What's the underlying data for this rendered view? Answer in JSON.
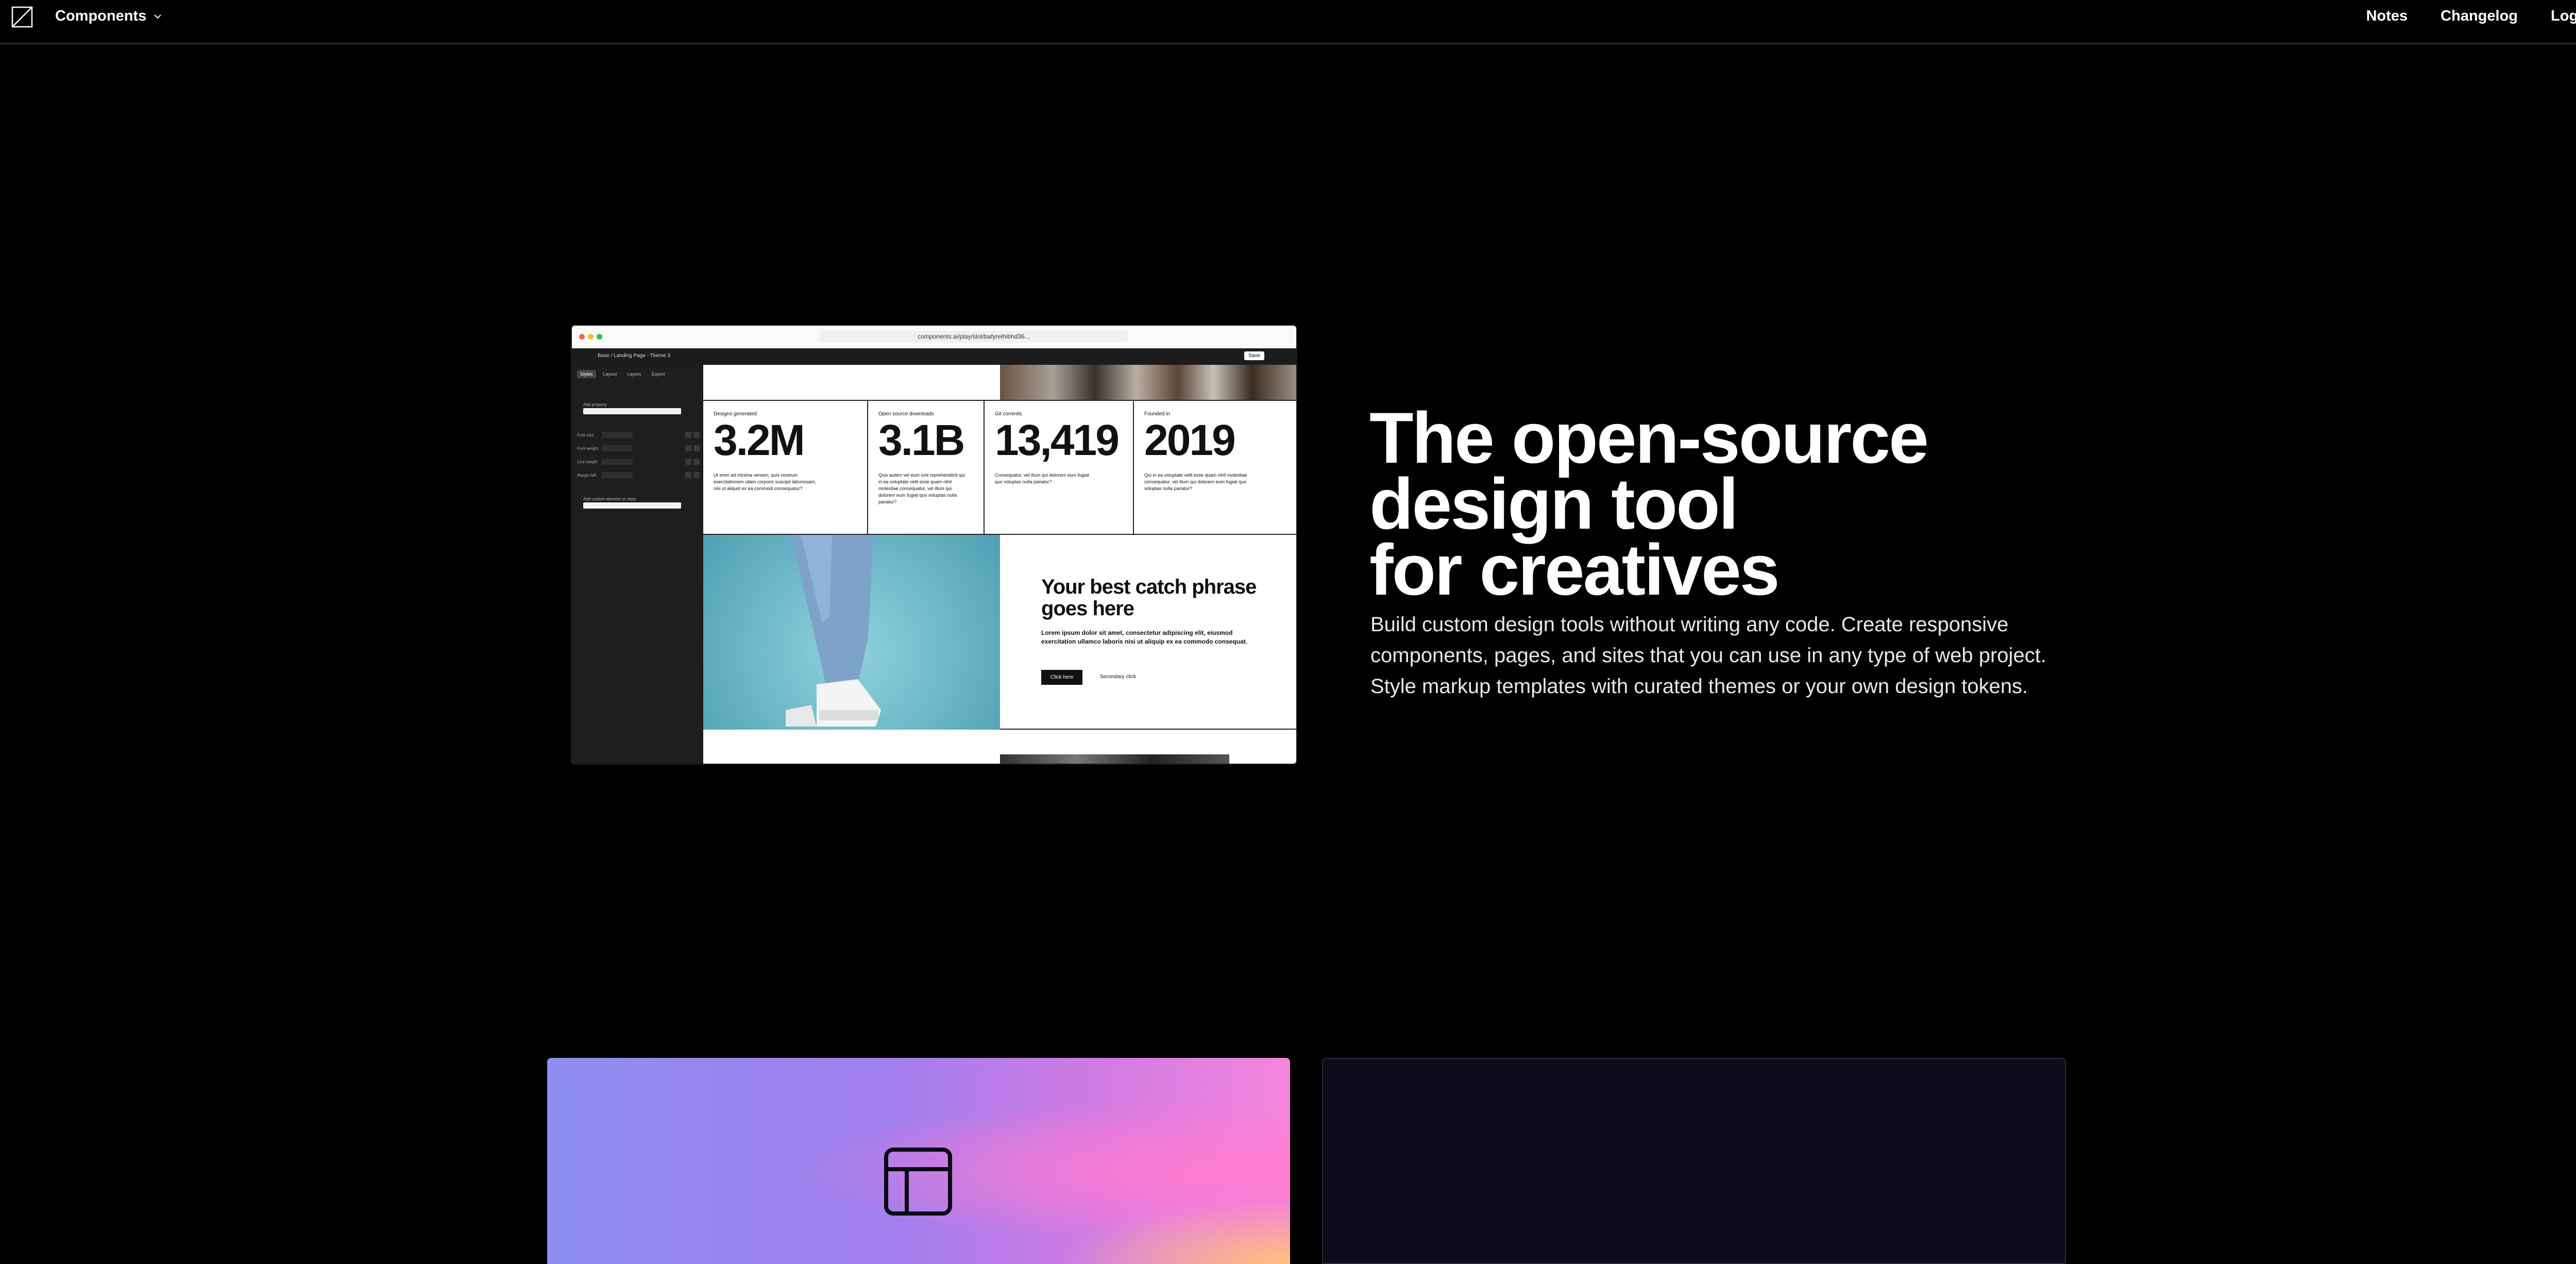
{
  "nav": {
    "brand_label": "Components",
    "links": [
      "Notes",
      "Changelog",
      "Log in"
    ]
  },
  "mockup": {
    "url": "components.ai/play/slot/bafyreihibhd36...",
    "breadcrumb": "Base  /  Landing Page - Theme 3",
    "save_label": "Save",
    "sidebar_tabs": [
      "Styles",
      "Layout",
      "Layers",
      "Export"
    ],
    "sidebar_labels": [
      "Add property",
      "Font size",
      "Font weight",
      "Line height",
      "Margin left",
      "Add custom element or class"
    ],
    "stats": [
      {
        "caption": "Designs generated",
        "value": "3.2M",
        "desc": "Ut enim ad minima veniam, quis nostrum exercitationem ullam corporis suscipit laboriosam, nisi ut aliquid ex ea commodi consequatur?"
      },
      {
        "caption": "Open source downloads",
        "value": "3.1B",
        "desc": "Quis autem vel eum iure reprehenderit qui in ea voluptate velit esse quam nihil molestiae consequatur, vel illum qui dolorem eum fugiat quo voluptas nulla pariatur?"
      },
      {
        "caption": "Git commits",
        "value": "13,419",
        "desc": "Consequatur, vel illum qui dolorem eum fugiat quo voluptas nulla pariatur?"
      },
      {
        "caption": "Founded in",
        "value": "2019",
        "desc": "Qui in ea voluptate velit esse quam nihil molestiae consequatur, vel illum qui dolorem eum fugiat quo voluptas nulla pariatur?"
      }
    ],
    "promo_heading": "Your best catch phrase goes here",
    "promo_body": "Lorem ipsum dolor sit amet, consectetur adipiscing elit, eiusmod exercitation ullamco laboris nisi ut aliquip ex ea commodo consequat.",
    "primary_btn": "Click here",
    "secondary_btn": "Secondary click"
  },
  "hero": {
    "title_lines": [
      "The open-source",
      "design tool",
      "for creatives"
    ],
    "subtitle": "Build custom design tools without writing any code. Create responsive components, pages, and sites that you can use in any type of web project. Style markup templates with curated themes or your own design tokens."
  },
  "icons": {
    "logo": "logo-icon",
    "brand_chevron": "chevron-down-icon",
    "card_icon": "layout-icon"
  },
  "colors": {
    "background": "#000000",
    "card_dark": "#0d0b1c"
  }
}
